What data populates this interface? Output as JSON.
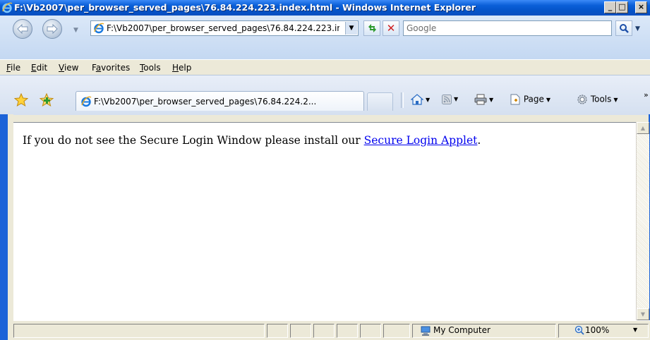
{
  "window": {
    "title": "F:\\Vb2007\\per_browser_served_pages\\76.84.224.223.index.html - Windows Internet Explorer",
    "minimize": "_",
    "maximize": "□",
    "close": "×"
  },
  "address": {
    "url": "F:\\Vb2007\\per_browser_served_pages\\76.84.224.223.index.html",
    "search_placeholder": "Google"
  },
  "menu": {
    "items": [
      {
        "label": "File",
        "accel": "F"
      },
      {
        "label": "Edit",
        "accel": "E"
      },
      {
        "label": "View",
        "accel": "V"
      },
      {
        "label": "Favorites",
        "accel": "a"
      },
      {
        "label": "Tools",
        "accel": "T"
      },
      {
        "label": "Help",
        "accel": "H"
      }
    ]
  },
  "tabs": {
    "active_label": "F:\\Vb2007\\per_browser_served_pages\\76.84.224.2..."
  },
  "toolbar": {
    "page_label": "Page",
    "tools_label": "Tools"
  },
  "content": {
    "text_before_link": "If you do not see the Secure Login Window please install our ",
    "link_text": "Secure Login Applet",
    "text_after_link": "."
  },
  "status": {
    "zone": "My Computer",
    "zoom": "100%"
  },
  "icons": {
    "title": "ie-icon",
    "back": "back-arrow-icon",
    "forward": "forward-arrow-icon",
    "refresh": "refresh-icon",
    "stop": "stop-icon",
    "search": "search-icon",
    "favorites": "star-icon",
    "add_favorites": "add-favorites-icon",
    "home": "home-icon",
    "feeds": "rss-icon",
    "print": "printer-icon",
    "page": "page-icon",
    "tools": "gear-icon",
    "zone": "computer-icon",
    "zoom": "zoom-icon"
  }
}
